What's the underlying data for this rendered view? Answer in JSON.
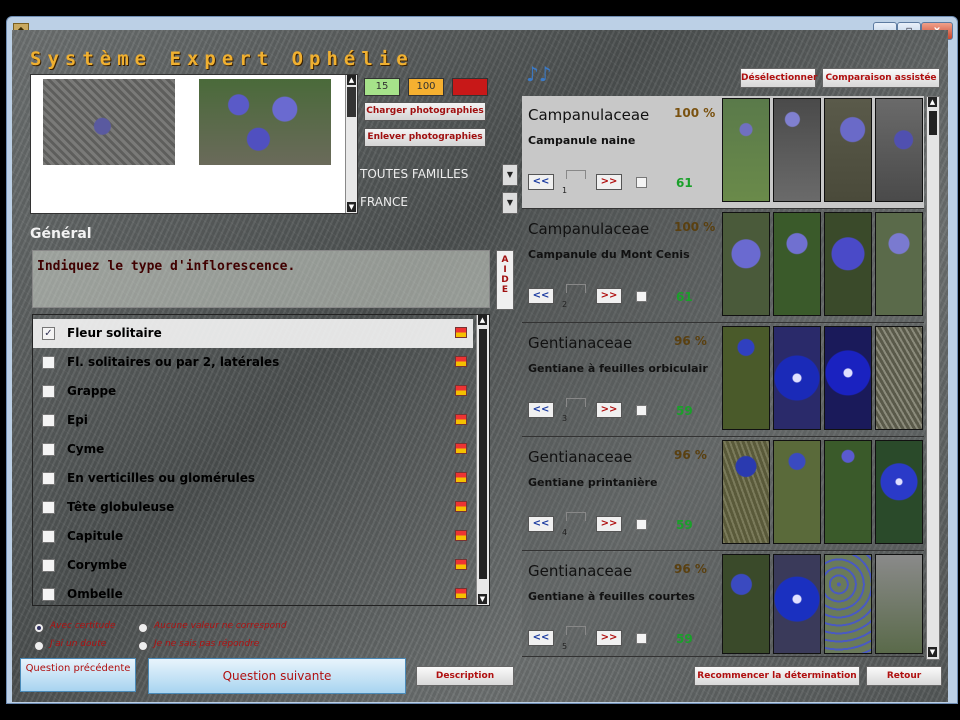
{
  "window": {
    "min": "–",
    "max": "▫",
    "close": "x"
  },
  "app": {
    "title": "Système Expert Ophélie",
    "icon": "app-icon"
  },
  "photos": {
    "thumbnails": [
      "photo-thumbnail-rocky-ground",
      "photo-thumbnail-blue-flowers"
    ]
  },
  "badges": [
    "15",
    "100",
    ""
  ],
  "buttons": {
    "load_photos": "Charger photographies",
    "remove_photos": "Enlever photographies",
    "deselect": "Désélectionner",
    "assisted_compare": "Comparaison assistée",
    "prev_question": "Question précédente",
    "next_question": "Question suivante",
    "description": "Description",
    "restart": "Recommencer la détermination",
    "back": "Retour"
  },
  "filters": {
    "family": "TOUTES FAMILLES",
    "region": "FRANCE"
  },
  "section_title": "Général",
  "question": "Indiquez le type d'inflorescence.",
  "aide_letters": [
    "A",
    "I",
    "D",
    "E"
  ],
  "options": [
    {
      "label": "Fleur solitaire",
      "checked": true
    },
    {
      "label": "Fl. solitaires ou par 2, latérales",
      "checked": false
    },
    {
      "label": "Grappe",
      "checked": false
    },
    {
      "label": "Epi",
      "checked": false
    },
    {
      "label": "Cyme",
      "checked": false
    },
    {
      "label": "En verticilles ou glomérules",
      "checked": false
    },
    {
      "label": "Tête globuleuse",
      "checked": false
    },
    {
      "label": "Capitule",
      "checked": false
    },
    {
      "label": "Corymbe",
      "checked": false
    },
    {
      "label": "Ombelle",
      "checked": false
    }
  ],
  "answer_modes": [
    {
      "label": "Avec certitude",
      "selected": true
    },
    {
      "label": "Aucune valeur ne correspond",
      "selected": false
    },
    {
      "label": "J'ai un doute",
      "selected": false
    },
    {
      "label": "Je ne sais pas répondre",
      "selected": false
    }
  ],
  "results": [
    {
      "family": "Campanulaceae",
      "percent": "100 %",
      "species": "Campanule naine",
      "score": "61",
      "rank": "1",
      "colors": [
        "#6a8a4a",
        "#5a5a5a",
        "#4a4a7a",
        "#6a6a6a"
      ]
    },
    {
      "family": "Campanulaceae",
      "percent": "100 %",
      "species": "Campanule du Mont Cenis",
      "score": "61",
      "rank": "2",
      "colors": [
        "#5a5aa8",
        "#4a6a3a",
        "#4444a0",
        "#6a7a5a"
      ]
    },
    {
      "family": "Gentianaceae",
      "percent": "96 %",
      "species": "Gentiane à feuilles orbiculair",
      "score": "59",
      "rank": "3",
      "colors": [
        "#4a5a2a",
        "#1a2ab8",
        "#1a22c0",
        "#7a7a6a"
      ]
    },
    {
      "family": "Gentianaceae",
      "percent": "96 %",
      "species": "Gentiane printanière",
      "score": "59",
      "rank": "4",
      "colors": [
        "#6a6a4a",
        "#5a6a3a",
        "#3a5a2a",
        "#2a3aa8"
      ]
    },
    {
      "family": "Gentianaceae",
      "percent": "96 %",
      "species": "Gentiane à feuilles courtes",
      "score": "59",
      "rank": "5",
      "colors": [
        "#3a4a2a",
        "#1a30c0",
        "#5a6a4a",
        "#7a7a7a"
      ]
    }
  ],
  "nav": {
    "prev": "<<",
    "next": ">>"
  }
}
